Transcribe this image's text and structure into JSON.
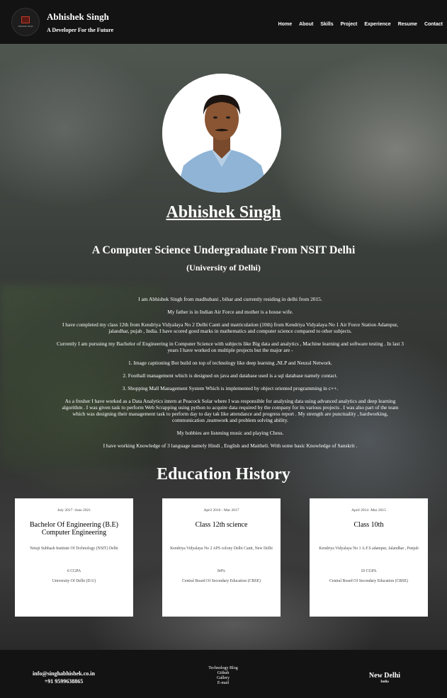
{
  "header": {
    "logo_text": "Abhishek Singh",
    "name": "Abhishek Singh",
    "tagline": "A Developer For the Future",
    "nav": [
      "Home",
      "About",
      "Skills",
      "Project",
      "Experience",
      "Resume",
      "Contact"
    ]
  },
  "profile": {
    "name": "Abhishek Singh",
    "title": "A Computer Science Undergraduate From NSIT Delhi",
    "subtitle": "(University of Delhi)",
    "about": [
      "I am Abhishek Singh from madhubani , bihar and currently residing in delhi from 2015.",
      "My father is in Indian Air Force and mother is a house wife.",
      "I have completed my class 12th from Kendriya Vidyalaya No 2 Delhi Cantt and matriculation (10th) from Kendriya Vidyalaya No 1 Air Force Station Adampur, jalandhar, pujab , India. I have scored good marks in mathematics and computer science compared to other subjects.",
      "Currently I am pursuing my Bachelor of Engineering in Computer Science with subjects like Big data and analytics , Machine learning and software testing . In last 3 years I have worked on multiple projects but the major are -",
      "1. Image captioning Bot build on top of technology like deep learning ,NLP and Neural Network.",
      "2. Football management which is designed on java and database used is a sql database namely contact.",
      "3. Shopping Mall Management System Which is implemented by object oriented programming in c++.",
      "As a fresher I have worked as a Data Analytics intern at Peacock Solar where I was responsible for analysing data using advanced analytics and deep learning algorithm . I was given task to perform Web Scrapping using python to acquire data required by the company for its various projects . I was also part of the team which was designing their management task to perform day to day tak like attendance and progress report . My strength are punctuality , hardworking, communication ,teamwork and problem solving ability.",
      "My hobbies are listening music and playing Chess.",
      "I have working Knowledge of 3 language namely Hindi , English and Maitheli. With some basic Knowledge of Sanskrit ."
    ]
  },
  "education": {
    "heading": "Education History",
    "items": [
      {
        "date": "July 2017 -June 2021",
        "degree": "Bachelor Of Engineering (B.E) Computer Engineering",
        "school": "Netaji Subhash Institute Of Technology (NSIT) Delhi",
        "score": "6 CGPA",
        "board": "University Of Delhi (D.U)"
      },
      {
        "date": "April 2016 - Mar 2017",
        "degree": "Class 12th science",
        "school": "Kendriya Vidyalaya No 2 APS colony Delhi Cantt, New Delhi",
        "score": "84%",
        "board": "Central Board Of Secondary Education (CBSE)"
      },
      {
        "date": "April 2014 -Mar 2015",
        "degree": "Class 10th",
        "school": "Kendriya Vidyalaya No 1 A.F.S adampur, Jalandhar , Punjab",
        "score": "10 CGPA",
        "board": "Central Board Of Secondary Education (CBSE)"
      }
    ]
  },
  "footer": {
    "email": "info@singhabhishek.co.in",
    "phone": "+91 9599638865",
    "links": [
      "Technology Blog",
      "Github",
      "Gallery",
      "E-mail"
    ],
    "city": "New Delhi",
    "country": "India"
  },
  "colors": {
    "navbar": "#131313",
    "card": "#ffffff",
    "text": "#ffffff"
  }
}
